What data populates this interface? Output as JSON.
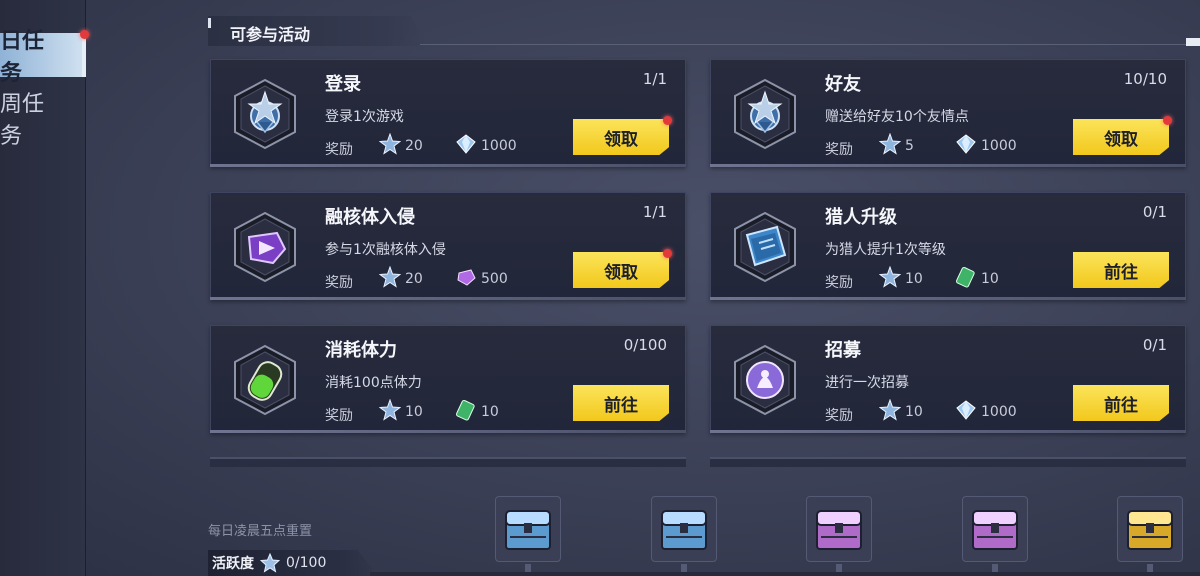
{
  "sidebar": {
    "tabs": [
      {
        "label": "日任务",
        "active": true
      },
      {
        "label": "周任务",
        "active": false
      }
    ]
  },
  "section": {
    "title": "可参与活动"
  },
  "reward_label": "奖励",
  "tasks": [
    {
      "name": "登录",
      "desc": "登录1次游戏",
      "progress": "1/1",
      "rewards": [
        "20",
        "1000"
      ],
      "button": "领取",
      "claimable": true,
      "icon": "medal-star-icon"
    },
    {
      "name": "好友",
      "desc": "赠送给好友10个友情点",
      "progress": "10/10",
      "rewards": [
        "5",
        "1000"
      ],
      "button": "领取",
      "claimable": true,
      "icon": "medal-star-icon"
    },
    {
      "name": "融核体入侵",
      "desc": "参与1次融核体入侵",
      "progress": "1/1",
      "rewards": [
        "20",
        "500"
      ],
      "button": "领取",
      "claimable": true,
      "icon": "purple-crystal-icon"
    },
    {
      "name": "猎人升级",
      "desc": "为猎人提升1次等级",
      "progress": "0/1",
      "rewards": [
        "10",
        "10"
      ],
      "button": "前往",
      "claimable": false,
      "icon": "blue-book-icon"
    },
    {
      "name": "消耗体力",
      "desc": "消耗100点体力",
      "progress": "0/100",
      "rewards": [
        "10",
        "10"
      ],
      "button": "前往",
      "claimable": false,
      "icon": "green-potion-icon"
    },
    {
      "name": "招募",
      "desc": "进行一次招募",
      "progress": "0/1",
      "rewards": [
        "10",
        "1000"
      ],
      "button": "前往",
      "claimable": false,
      "icon": "recruit-puzzle-icon"
    }
  ],
  "activity": {
    "reset_note": "每日凌晨五点重置",
    "label": "活跃度",
    "value": "0/100"
  },
  "colors": {
    "button_yellow": "#f5cf2a",
    "notify_red": "#e23a3a"
  }
}
